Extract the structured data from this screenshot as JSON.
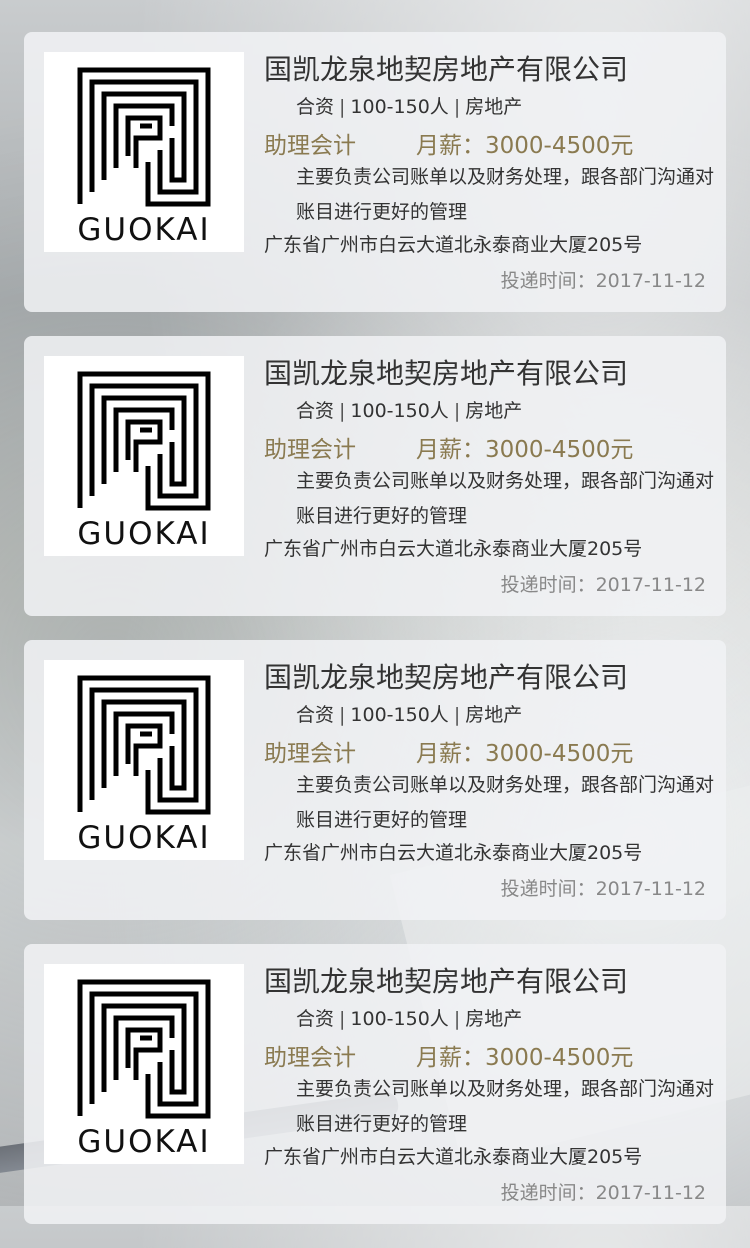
{
  "jobs": [
    {
      "logo_text": "GUOKAI",
      "company": "国凯龙泉地契房地产有限公司",
      "meta": [
        "合资",
        "100-150人",
        "房地产"
      ],
      "position": "助理会计",
      "salary": "月薪：3000-4500元",
      "description": "主要负责公司账单以及财务处理，跟各部门沟通对账目进行更好的管理",
      "address": "广东省广州市白云大道北永泰商业大厦205号",
      "time": "投递时间：2017-11-12"
    },
    {
      "logo_text": "GUOKAI",
      "company": "国凯龙泉地契房地产有限公司",
      "meta": [
        "合资",
        "100-150人",
        "房地产"
      ],
      "position": "助理会计",
      "salary": "月薪：3000-4500元",
      "description": "主要负责公司账单以及财务处理，跟各部门沟通对账目进行更好的管理",
      "address": "广东省广州市白云大道北永泰商业大厦205号",
      "time": "投递时间：2017-11-12"
    },
    {
      "logo_text": "GUOKAI",
      "company": "国凯龙泉地契房地产有限公司",
      "meta": [
        "合资",
        "100-150人",
        "房地产"
      ],
      "position": "助理会计",
      "salary": "月薪：3000-4500元",
      "description": "主要负责公司账单以及财务处理，跟各部门沟通对账目进行更好的管理",
      "address": "广东省广州市白云大道北永泰商业大厦205号",
      "time": "投递时间：2017-11-12"
    },
    {
      "logo_text": "GUOKAI",
      "company": "国凯龙泉地契房地产有限公司",
      "meta": [
        "合资",
        "100-150人",
        "房地产"
      ],
      "position": "助理会计",
      "salary": "月薪：3000-4500元",
      "description": "主要负责公司账单以及财务处理，跟各部门沟通对账目进行更好的管理",
      "address": "广东省广州市白云大道北永泰商业大厦205号",
      "time": "投递时间：2017-11-12"
    }
  ]
}
